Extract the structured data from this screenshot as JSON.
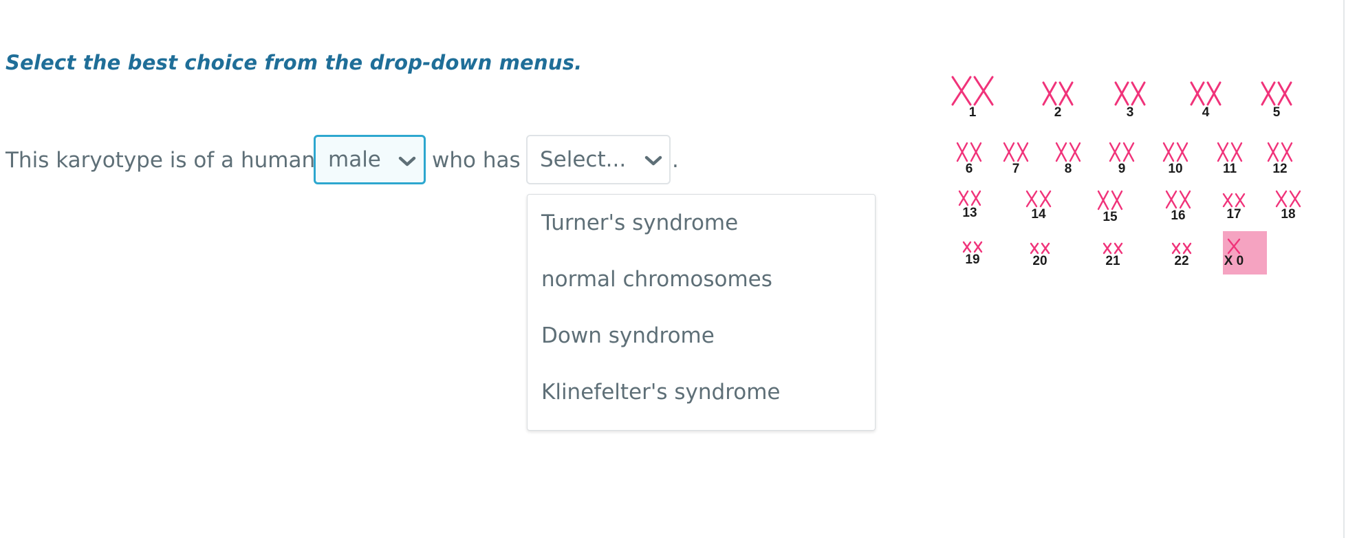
{
  "instruction": "Select the best choice from the drop-down menus.",
  "sentence": {
    "part1": "This karyotype is of a human",
    "part2": "who has",
    "part3": "."
  },
  "select_sex": {
    "value": "male"
  },
  "select_condition": {
    "value": "Select...",
    "options": [
      "Turner's syndrome",
      "normal chromosomes",
      "Down syndrome",
      "Klinefelter's syndrome"
    ]
  },
  "karyotype": {
    "chromosomes": [
      "1",
      "2",
      "3",
      "4",
      "5",
      "6",
      "7",
      "8",
      "9",
      "10",
      "11",
      "12",
      "13",
      "14",
      "15",
      "16",
      "17",
      "18",
      "19",
      "20",
      "21",
      "22",
      "X 0"
    ],
    "chromosome_color": "#f0337a",
    "highlight_color": "#f5a3c1"
  },
  "colors": {
    "instruction": "#1f6e98",
    "text": "#5e6f77",
    "focus_border": "#2da7cf"
  }
}
